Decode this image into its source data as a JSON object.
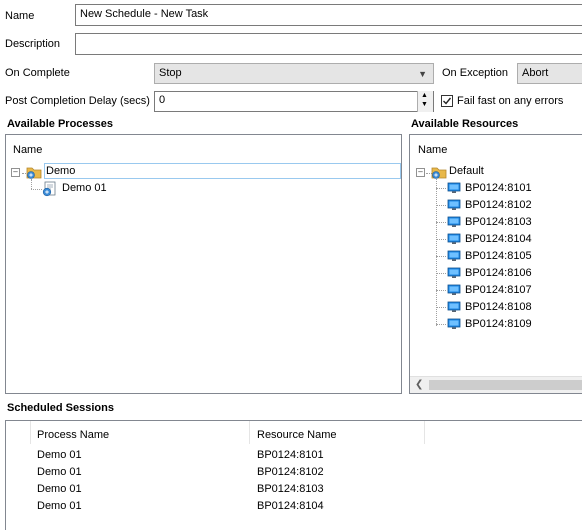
{
  "form": {
    "name_label": "Name",
    "name_value": "New Schedule - New Task",
    "description_label": "Description",
    "description_value": "",
    "on_complete_label": "On Complete",
    "on_complete_value": "Stop",
    "on_exception_label": "On Exception",
    "on_exception_value": "Abort",
    "post_delay_label": "Post Completion Delay (secs)",
    "post_delay_value": "0",
    "fail_fast_label": "Fail fast on any errors",
    "fail_fast_checked": true
  },
  "processes": {
    "title": "Available Processes",
    "column": "Name",
    "group": "Demo",
    "items": [
      "Demo 01"
    ]
  },
  "resources": {
    "title": "Available Resources",
    "column": "Name",
    "group": "Default",
    "items": [
      "BP0124:8101",
      "BP0124:8102",
      "BP0124:8103",
      "BP0124:8104",
      "BP0124:8105",
      "BP0124:8106",
      "BP0124:8107",
      "BP0124:8108",
      "BP0124:8109"
    ]
  },
  "sessions": {
    "title": "Scheduled Sessions",
    "columns": [
      "Process Name",
      "Resource Name"
    ],
    "rows": [
      [
        "Demo 01",
        "BP0124:8101"
      ],
      [
        "Demo 01",
        "BP0124:8102"
      ],
      [
        "Demo 01",
        "BP0124:8103"
      ],
      [
        "Demo 01",
        "BP0124:8104"
      ]
    ]
  },
  "colors": {
    "folder": "#e8b84a",
    "monitor": "#1e88e5",
    "selection_border": "#99c9ef"
  },
  "icons": {
    "expander": "minus-square-icon",
    "group": "folder-icon",
    "process": "process-icon",
    "resource": "computer-icon",
    "combo_arrow": "chevron-down-icon",
    "spin_up": "spin-up-icon",
    "spin_down": "spin-down-icon",
    "scroll_left": "scroll-left-icon"
  }
}
